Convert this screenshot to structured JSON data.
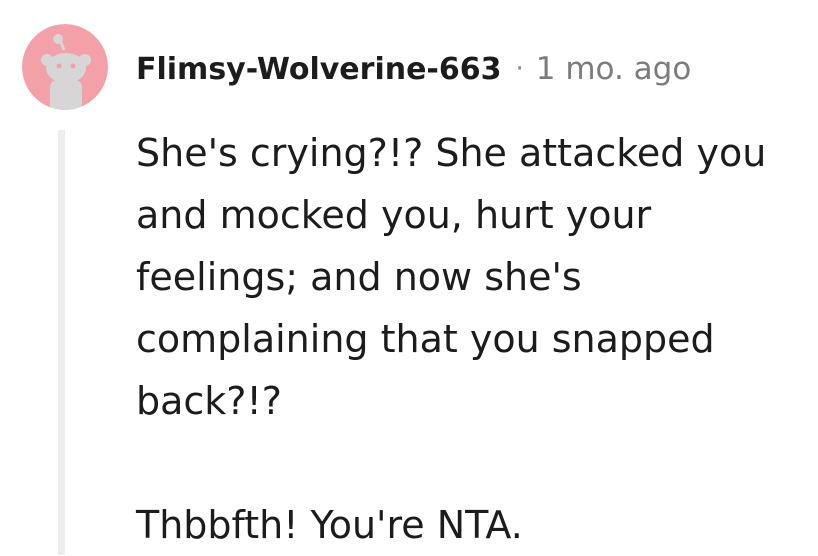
{
  "comment": {
    "author": "Flimsy-Wolverine-663",
    "separator": "·",
    "timestamp": "1 mo. ago",
    "avatar": {
      "icon": "snoo-avatar-icon",
      "background": "#f4a0a8",
      "figure_color": "#d6d6d6"
    },
    "body": {
      "paragraphs": [
        "She's crying?!? She attacked you and mocked you, hurt your feelings; and now she's complaining that you snapped back?!?",
        "Thbbfth! You're NTA."
      ]
    }
  },
  "colors": {
    "text": "#1c1c1c",
    "meta": "#7c7c7c",
    "thread_line": "#ededed"
  }
}
